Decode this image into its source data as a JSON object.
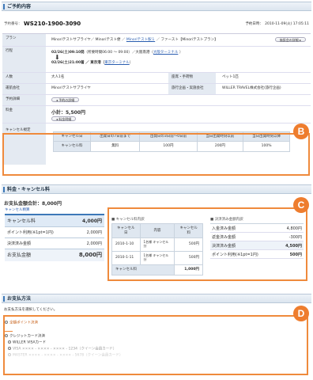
{
  "reservation": {
    "section_title": "ご予約内容",
    "res_no_label": "予約番号：",
    "res_no": "WS210-1900-3090",
    "res_date": "予約日時：　2010-11-09(火) 17:05:11"
  },
  "rows": {
    "plan": {
      "label": "プラン",
      "value": "Minoriテストサブライヤ／ Minoriテスト便 ／ ",
      "link": "Minoriテスト駅１",
      "value2": " ／ ファースト【Minoriテストプラン】",
      "btn": "施設会の詳細 ▸"
    },
    "itinerary": {
      "label": "行程",
      "line1": "02/26(土)09:10発",
      "line1b": "（所要時間06:00 〜 09:00）／大阪南港（",
      "line1link": "大阪ターミナル",
      "line1c": " ）",
      "line2": "02/26(土)21:00着 ／ 東京港（",
      "line2link": "東京ターミナル",
      "line2c": "）"
    },
    "people": {
      "label": "人数",
      "value": "大人1名",
      "label2": "座席・手荷物",
      "value2": "ペット1匹"
    },
    "operator": {
      "label": "運航会社",
      "value": "Minoriテストサブライヤ",
      "label2": "旅行企画・実施会社",
      "value2": "WILLER TRAVEL株式会社(旅行企画)"
    },
    "detail": {
      "label": "予約詳細",
      "btn": "◂ 予約の詳細"
    },
    "fee": {
      "label": "料金",
      "value": "小計：5,500円",
      "btn": "◂ 料金明細"
    },
    "cancel": {
      "label": "キャンセル規定",
      "headers": [
        "キャンセル日",
        "出発日の7日前まで",
        "出発日の3日前〜0日前",
        "当日出発時刻以前",
        "当日出発時刻以降"
      ],
      "row_label": "キャンセル料",
      "cells": [
        "無料",
        "100円",
        "200円",
        "100%"
      ]
    }
  },
  "fees": {
    "section_title": "料金・キャンセル料",
    "total": "お支払金額合計：8,000円",
    "left": {
      "title": "キャンセル精算",
      "rows": [
        {
          "label": "キャンセル料",
          "value": "4,000円"
        },
        {
          "label": "ポイント利用(※1pt=1円)",
          "value": "2,000円"
        },
        {
          "label": "決済済み金額",
          "value": "2,000円"
        }
      ],
      "total_label": "お支払金額",
      "total_value": "8,000円"
    },
    "mid": {
      "title": "■ キャンセル料内訳",
      "headers": [
        "キャンセル日",
        "内容",
        "キャンセル料"
      ],
      "rows": [
        [
          "2010-1-10",
          "1名様\nキャンセル分",
          "500円"
        ],
        [
          "2010-1-11",
          "1名様\nキャンセル分",
          "500円"
        ]
      ],
      "total_label": "キャンセル料",
      "total_value": "1,000円"
    },
    "right": {
      "title": "■ 決済済み金額内訳",
      "rows": [
        {
          "label": "入金済み金額",
          "value": "4,800円"
        },
        {
          "label": "返金済み金額",
          "value": "-300円"
        },
        {
          "label": "決済済み金額",
          "value": "4,500円"
        },
        {
          "label": "ポイント利用(※1pt=1円)",
          "value": "500円"
        }
      ]
    }
  },
  "payment": {
    "section_title": "お支払方法",
    "instruction": "お支払方法を選択してください。",
    "opt1": "全額ポイント決済",
    "opt2": "クレジットカード決済",
    "card1": "WILLER VISAカード",
    "card2": "VISA ×××× - ×××× - ×××× - 1234（クイーン会員カード）",
    "card3": "MASTER ×××× - ×××× - ×××× - 5678（クイーン会員カード）"
  },
  "badges": {
    "b": "B",
    "c": "C",
    "d": "D"
  },
  "colors": {
    "accent": "#ee7d2e",
    "header": "#3d78b8"
  }
}
